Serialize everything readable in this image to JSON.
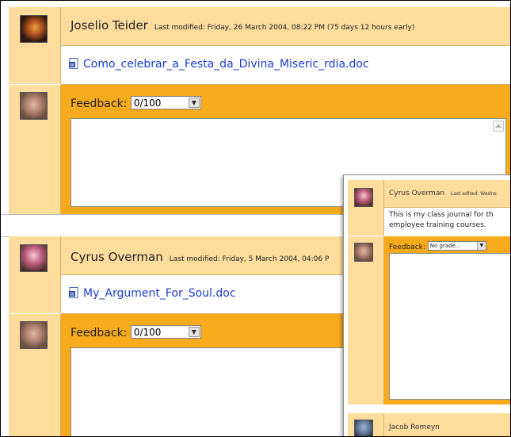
{
  "submissions": [
    {
      "student": "Joselio Teider",
      "meta": "Last modified: Friday, 26 March 2004, 08:22 PM (75 days 12 hours early)",
      "file": "Como_celebrar_a_Festa_da_Divina_Miseric_rdia.doc",
      "feedback_label": "Feedback:",
      "grade": "0/100"
    },
    {
      "student": "Cyrus Overman",
      "meta": "Last modified: Friday, 5 March 2004, 04:06 P",
      "file": "My_Argument_For_Soul.doc",
      "feedback_label": "Feedback:",
      "grade": "0/100"
    }
  ],
  "journal_overlay": {
    "student": "Cyrus Overman",
    "meta": "Last edited: Wedne",
    "entry_line1": "This is my class journal for th",
    "entry_line2": "employee training courses.",
    "feedback_label": "Feedback:",
    "grade": "No grade...",
    "next_student": "Jacob Romeyn"
  },
  "colors": {
    "header_bg": "#fddc9c",
    "feedback_bg": "#f7ab1c",
    "link": "#1a3ccd"
  },
  "icons": {
    "doc": "word-document-icon",
    "dropdown": "chevron-down-icon",
    "scroll": "scroll-up-icon"
  }
}
